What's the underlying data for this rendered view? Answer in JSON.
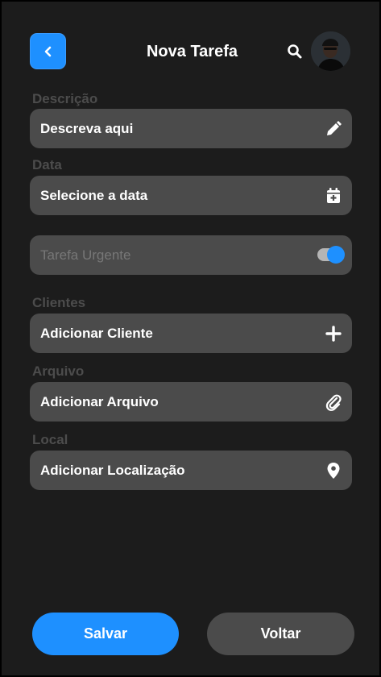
{
  "header": {
    "title": "Nova Tarefa"
  },
  "form": {
    "description": {
      "label": "Descrição",
      "placeholder": "Descreva aqui",
      "icon": "pencil-icon"
    },
    "date": {
      "label": "Data",
      "placeholder": "Selecione a data",
      "icon": "calendar-plus-icon"
    },
    "urgent": {
      "label": "Tarefa Urgente",
      "enabled": true
    },
    "clients": {
      "label": "Clientes",
      "action": "Adicionar Cliente",
      "icon": "plus-icon"
    },
    "file": {
      "label": "Arquivo",
      "action": "Adicionar Arquivo",
      "icon": "paperclip-icon"
    },
    "location": {
      "label": "Local",
      "action": "Adicionar Localização",
      "icon": "map-pin-icon"
    }
  },
  "buttons": {
    "save": "Salvar",
    "back": "Voltar"
  },
  "colors": {
    "accent": "#1e90ff",
    "background": "#1c1c1c",
    "field": "#4b4b4b",
    "label": "#4c4c4c"
  }
}
